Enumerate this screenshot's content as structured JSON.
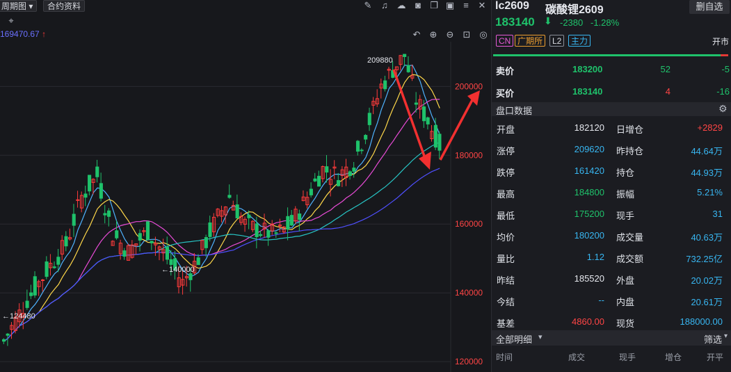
{
  "toolbar": {
    "period_label": "周期图",
    "period_caret": "▾",
    "contract_label": "合约资料",
    "icons": [
      "pencil-icon",
      "bell-icon",
      "cloud-icon",
      "camera-icon",
      "copy-icon",
      "screen-icon",
      "settings-icon",
      "close-icon",
      "collapse-icon",
      "ruler-icon"
    ]
  },
  "ma_readout": {
    "value": "169470.67",
    "arrow": "↑"
  },
  "chart_controls": [
    "undo-icon",
    "zoom-in-icon",
    "zoom-out-icon",
    "fit-icon",
    "eye-icon"
  ],
  "chart_data": {
    "type": "candlestick",
    "y_ticks": [
      "200000",
      "180000",
      "160000",
      "140000",
      "120000"
    ],
    "ylim": [
      117000,
      213000
    ],
    "annotations": [
      {
        "text": "209880",
        "side": "left"
      },
      {
        "text": "←140000",
        "side": "right"
      },
      {
        "text": "←124480",
        "side": "right"
      }
    ],
    "up_color": "#ff3b3b",
    "down_color": "#1fc26b"
  },
  "quote": {
    "code": "lc2609",
    "name": "碳酸锂2609",
    "delete_label": "删自选",
    "last": "183140",
    "arrow": "🡇",
    "change": "-2380",
    "change_pct": "-1.28%",
    "tags": [
      "CN",
      "广期所",
      "L2",
      "主力"
    ],
    "status": "开市"
  },
  "order_book": {
    "sell": {
      "label": "卖价",
      "price": "183200",
      "volume": "52",
      "change": "-5"
    },
    "buy": {
      "label": "买价",
      "price": "183140",
      "volume": "4",
      "change": "-16"
    }
  },
  "panel": {
    "title": "盘口数据",
    "rows": [
      {
        "l1": "开盘",
        "v1": "182120",
        "l2": "日增仓",
        "v2": "+2829"
      },
      {
        "l1": "涨停",
        "v1": "209620",
        "l2": "昨持仓",
        "v2": "44.64万"
      },
      {
        "l1": "跌停",
        "v1": "161420",
        "l2": "持仓",
        "v2": "44.93万"
      },
      {
        "l1": "最高",
        "v1": "184800",
        "l2": "振幅",
        "v2": "5.21%"
      },
      {
        "l1": "最低",
        "v1": "175200",
        "l2": "现手",
        "v2": "31"
      },
      {
        "l1": "均价",
        "v1": "180200",
        "l2": "成交量",
        "v2": "40.63万"
      },
      {
        "l1": "量比",
        "v1": "1.12",
        "l2": "成交额",
        "v2": "732.25亿"
      },
      {
        "l1": "昨结",
        "v1": "185520",
        "l2": "外盘",
        "v2": "20.02万"
      },
      {
        "l1": "今结",
        "v1": "--",
        "l2": "内盘",
        "v2": "20.61万"
      },
      {
        "l1": "基差",
        "v1": "4860.00",
        "l2": "现货",
        "v2": "188000.00"
      }
    ]
  },
  "trades": {
    "title": "全部明细",
    "caret": "▾",
    "filter": "筛选",
    "columns": [
      "时间",
      "成交",
      "现手",
      "增仓",
      "开平"
    ]
  }
}
